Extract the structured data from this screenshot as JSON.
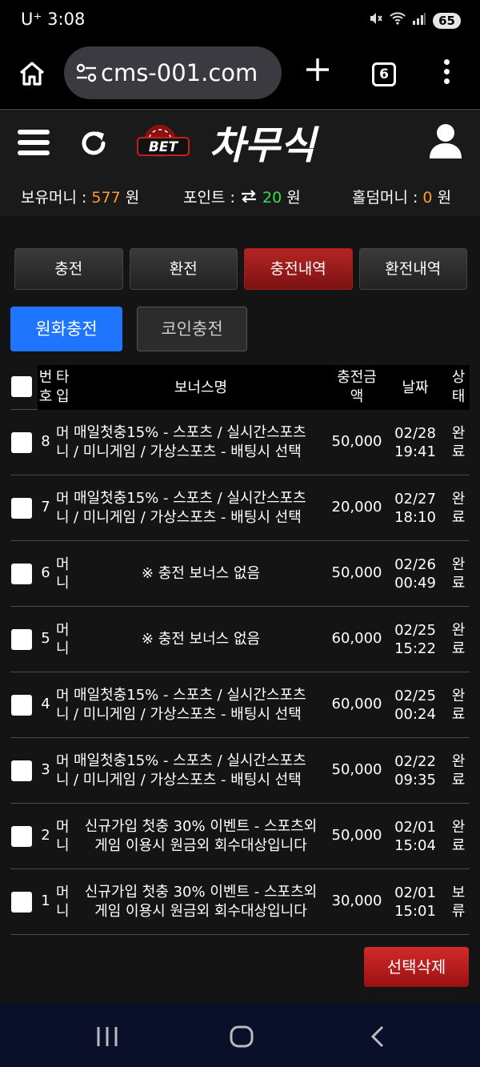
{
  "status_bar": {
    "time": "3:08",
    "carrier": "U⁺",
    "battery": "65"
  },
  "browser": {
    "url": "cms-001.com",
    "tab_count": "6"
  },
  "site": {
    "logo_text": "BET 차무식",
    "wallet": {
      "balance_label": "보유머니 :",
      "balance_value": "577",
      "balance_unit": "원",
      "points_label": "포인트 :",
      "points_value": "20",
      "points_unit": "원",
      "holdem_label": "홀덤머니 :",
      "holdem_value": "0",
      "holdem_unit": "원"
    }
  },
  "main_tabs": [
    {
      "label": "충전",
      "active": false
    },
    {
      "label": "환전",
      "active": false
    },
    {
      "label": "충전내역",
      "active": true
    },
    {
      "label": "환전내역",
      "active": false
    }
  ],
  "sub_tabs": [
    {
      "label": "원화충전",
      "active": true
    },
    {
      "label": "코인충전",
      "active": false
    }
  ],
  "table": {
    "headers": {
      "no_line1": "번",
      "no_line2": "호",
      "type_line1": "타",
      "type_line2": "입",
      "name": "보너스명",
      "amount_line1": "충전금",
      "amount_line2": "액",
      "date": "날짜",
      "status_line1": "상",
      "status_line2": "태"
    },
    "rows": [
      {
        "no": "8",
        "type1": "머",
        "type2": "니",
        "name1": "매일첫충15% - 스포츠 / 실시간스포츠",
        "name2": "/ 미니게임 / 가상스포츠 - 배팅시 선택",
        "amount": "50,000",
        "date1": "02/28",
        "date2": "19:41",
        "stat1": "완",
        "stat2": "료"
      },
      {
        "no": "7",
        "type1": "머",
        "type2": "니",
        "name1": "매일첫충15% - 스포츠 / 실시간스포츠",
        "name2": "/ 미니게임 / 가상스포츠 - 배팅시 선택",
        "amount": "20,000",
        "date1": "02/27",
        "date2": "18:10",
        "stat1": "완",
        "stat2": "료"
      },
      {
        "no": "6",
        "type1": "머",
        "type2": "니",
        "name_single": "※ 충전 보너스 없음",
        "amount": "50,000",
        "date1": "02/26",
        "date2": "00:49",
        "stat1": "완",
        "stat2": "료"
      },
      {
        "no": "5",
        "type1": "머",
        "type2": "니",
        "name_single": "※ 충전 보너스 없음",
        "amount": "60,000",
        "date1": "02/25",
        "date2": "15:22",
        "stat1": "완",
        "stat2": "료"
      },
      {
        "no": "4",
        "type1": "머",
        "type2": "니",
        "name1": "매일첫충15% - 스포츠 / 실시간스포츠",
        "name2": "/ 미니게임 / 가상스포츠 - 배팅시 선택",
        "amount": "60,000",
        "date1": "02/25",
        "date2": "00:24",
        "stat1": "완",
        "stat2": "료"
      },
      {
        "no": "3",
        "type1": "머",
        "type2": "니",
        "name1": "매일첫충15% - 스포츠 / 실시간스포츠",
        "name2": "/ 미니게임 / 가상스포츠 - 배팅시 선택",
        "amount": "50,000",
        "date1": "02/22",
        "date2": "09:35",
        "stat1": "완",
        "stat2": "료"
      },
      {
        "no": "2",
        "type1": "머",
        "type2": "니",
        "name1": "신규가입 첫충 30% 이벤트 - 스포츠외",
        "name2": "게임 이용시 원금외 회수대상입니다",
        "amount": "50,000",
        "date1": "02/01",
        "date2": "15:04",
        "stat1": "완",
        "stat2": "료"
      },
      {
        "no": "1",
        "type1": "머",
        "type2": "니",
        "name1": "신규가입 첫충 30% 이벤트 - 스포츠외",
        "name2": "게임 이용시 원금외 회수대상입니다",
        "amount": "30,000",
        "date1": "02/01",
        "date2": "15:01",
        "stat1": "보",
        "stat2": "류"
      }
    ]
  },
  "delete_button": "선택삭제",
  "colors": {
    "accent_blue": "#1f75fe",
    "accent_red": "#b52424",
    "money_orange": "#ff9a2e",
    "points_green": "#3ddc4a"
  }
}
